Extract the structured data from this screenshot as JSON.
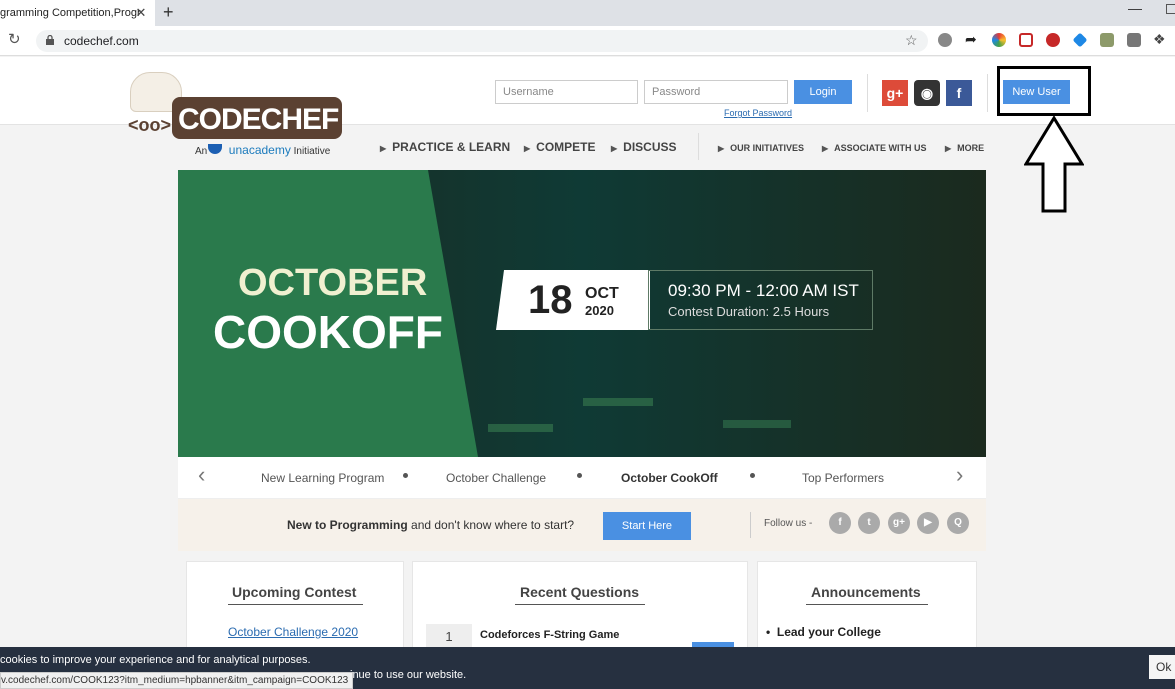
{
  "browser": {
    "tab_title": "gramming Competition,Progr",
    "tab_close": "✕",
    "new_tab": "+",
    "minimize": "—",
    "url": "codechef.com",
    "status_url": "v.codechef.com/COOK123?itm_medium=hpbanner&itm_campaign=COOK123"
  },
  "header": {
    "logo_text": "CODECHEF",
    "logo_sub_prefix": "An",
    "logo_sub_brand": "unacademy",
    "logo_sub_suffix": "Initiative",
    "username_placeholder": "Username",
    "password_placeholder": "Password",
    "login_label": "Login",
    "forgot_label": "Forgot Password",
    "new_user_label": "New User"
  },
  "nav": {
    "primary": [
      "PRACTICE & LEARN",
      "COMPETE",
      "DISCUSS"
    ],
    "secondary": [
      "OUR INITIATIVES",
      "ASSOCIATE WITH US",
      "MORE"
    ]
  },
  "banner": {
    "title_line1": "OCTOBER",
    "title_line2": "COOKOFF",
    "day": "18",
    "month": "OCT",
    "year": "2020",
    "time": "09:30 PM - 12:00 AM IST",
    "duration": "Contest Duration: 2.5 Hours"
  },
  "carousel": {
    "items": [
      "New Learning Program",
      "October Challenge",
      "October CookOff",
      "Top Performers"
    ],
    "active_index": 2
  },
  "help": {
    "bold": "New to Programming",
    "rest": " and don't know where to start?",
    "button": "Start Here",
    "follow_label": "Follow us -"
  },
  "panels": {
    "upcoming_title": "Upcoming Contest",
    "upcoming_first": "October Challenge 2020",
    "questions_title": "Recent Questions",
    "question_count": "1",
    "question_title": "Codeforces F-String Game",
    "announcements_title": "Announcements",
    "announcement_first": "Lead your College"
  },
  "cookie": {
    "line1": "cookies to improve your experience and for analytical purposes.",
    "line2": "inue to use our website.",
    "ok": "Ok"
  },
  "colors": {
    "brand_brown": "#5b4132",
    "button_blue": "#4a90e2",
    "banner_green": "#2a7a4c",
    "cookie_bg": "#263040"
  }
}
